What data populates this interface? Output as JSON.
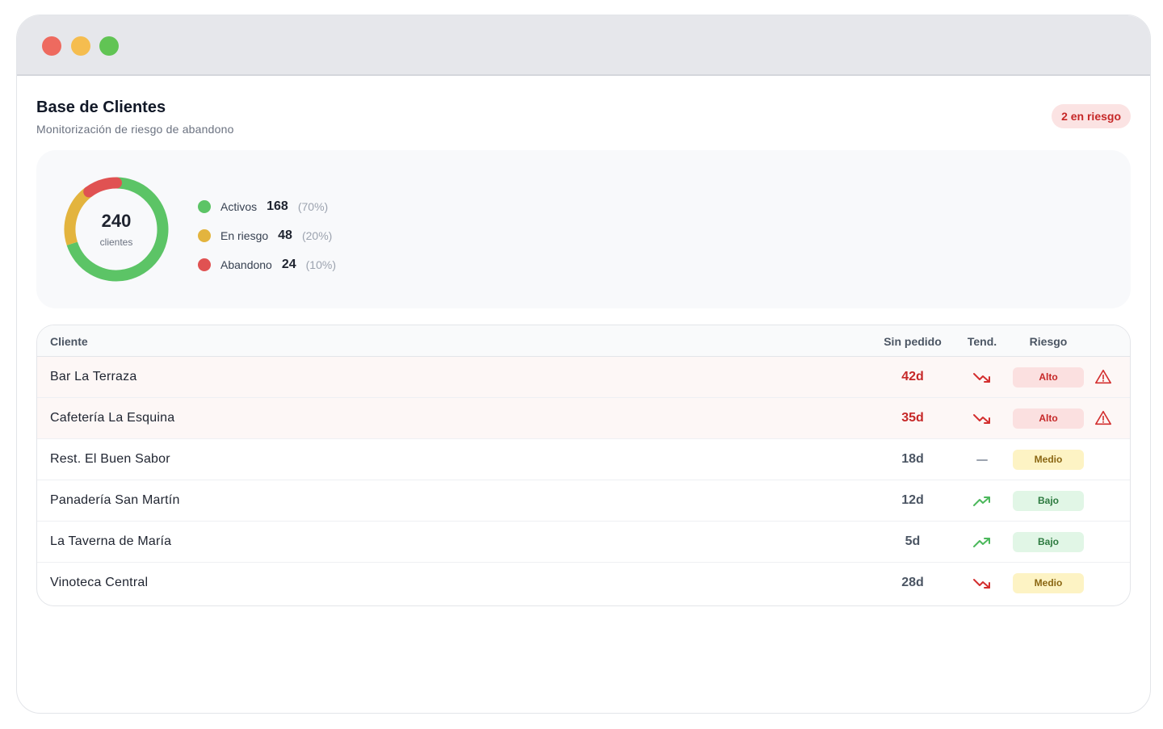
{
  "header": {
    "title": "Base de Clientes",
    "subtitle": "Monitorización de riesgo de abandono",
    "risk_badge": "2 en riesgo"
  },
  "summary": {
    "total": "240",
    "total_label": "clientes",
    "segments": [
      {
        "name": "Activos",
        "value": "168",
        "pct": "(70%)",
        "color": "#5cc466"
      },
      {
        "name": "En riesgo",
        "value": "48",
        "pct": "(20%)",
        "color": "#e3b43e"
      },
      {
        "name": "Abandono",
        "value": "24",
        "pct": "(10%)",
        "color": "#e05252"
      }
    ]
  },
  "table": {
    "columns": {
      "client": "Cliente",
      "days": "Sin pedido",
      "trend": "Tend.",
      "risk": "Riesgo"
    },
    "rows": [
      {
        "name": "Bar La Terraza",
        "days": "42d",
        "trend": "down",
        "risk": "Alto",
        "warning": true
      },
      {
        "name": "Cafetería La Esquina",
        "days": "35d",
        "trend": "down",
        "risk": "Alto",
        "warning": true
      },
      {
        "name": "Rest. El Buen Sabor",
        "days": "18d",
        "trend": "flat",
        "risk": "Medio",
        "warning": false
      },
      {
        "name": "Panadería San Martín",
        "days": "12d",
        "trend": "up",
        "risk": "Bajo",
        "warning": false
      },
      {
        "name": "La Taverna de María",
        "days": "5d",
        "trend": "up",
        "risk": "Bajo",
        "warning": false
      },
      {
        "name": "Vinoteca Central",
        "days": "28d",
        "trend": "down",
        "risk": "Medio",
        "warning": false
      }
    ]
  },
  "colors": {
    "red": "#c62828",
    "green": "#4cb85c",
    "amber": "#e3b43e"
  },
  "icons": {
    "trend_down": "trend-down-icon",
    "trend_up": "trend-up-icon",
    "trend_flat": "trend-flat-icon",
    "warning": "warning-triangle-icon"
  }
}
